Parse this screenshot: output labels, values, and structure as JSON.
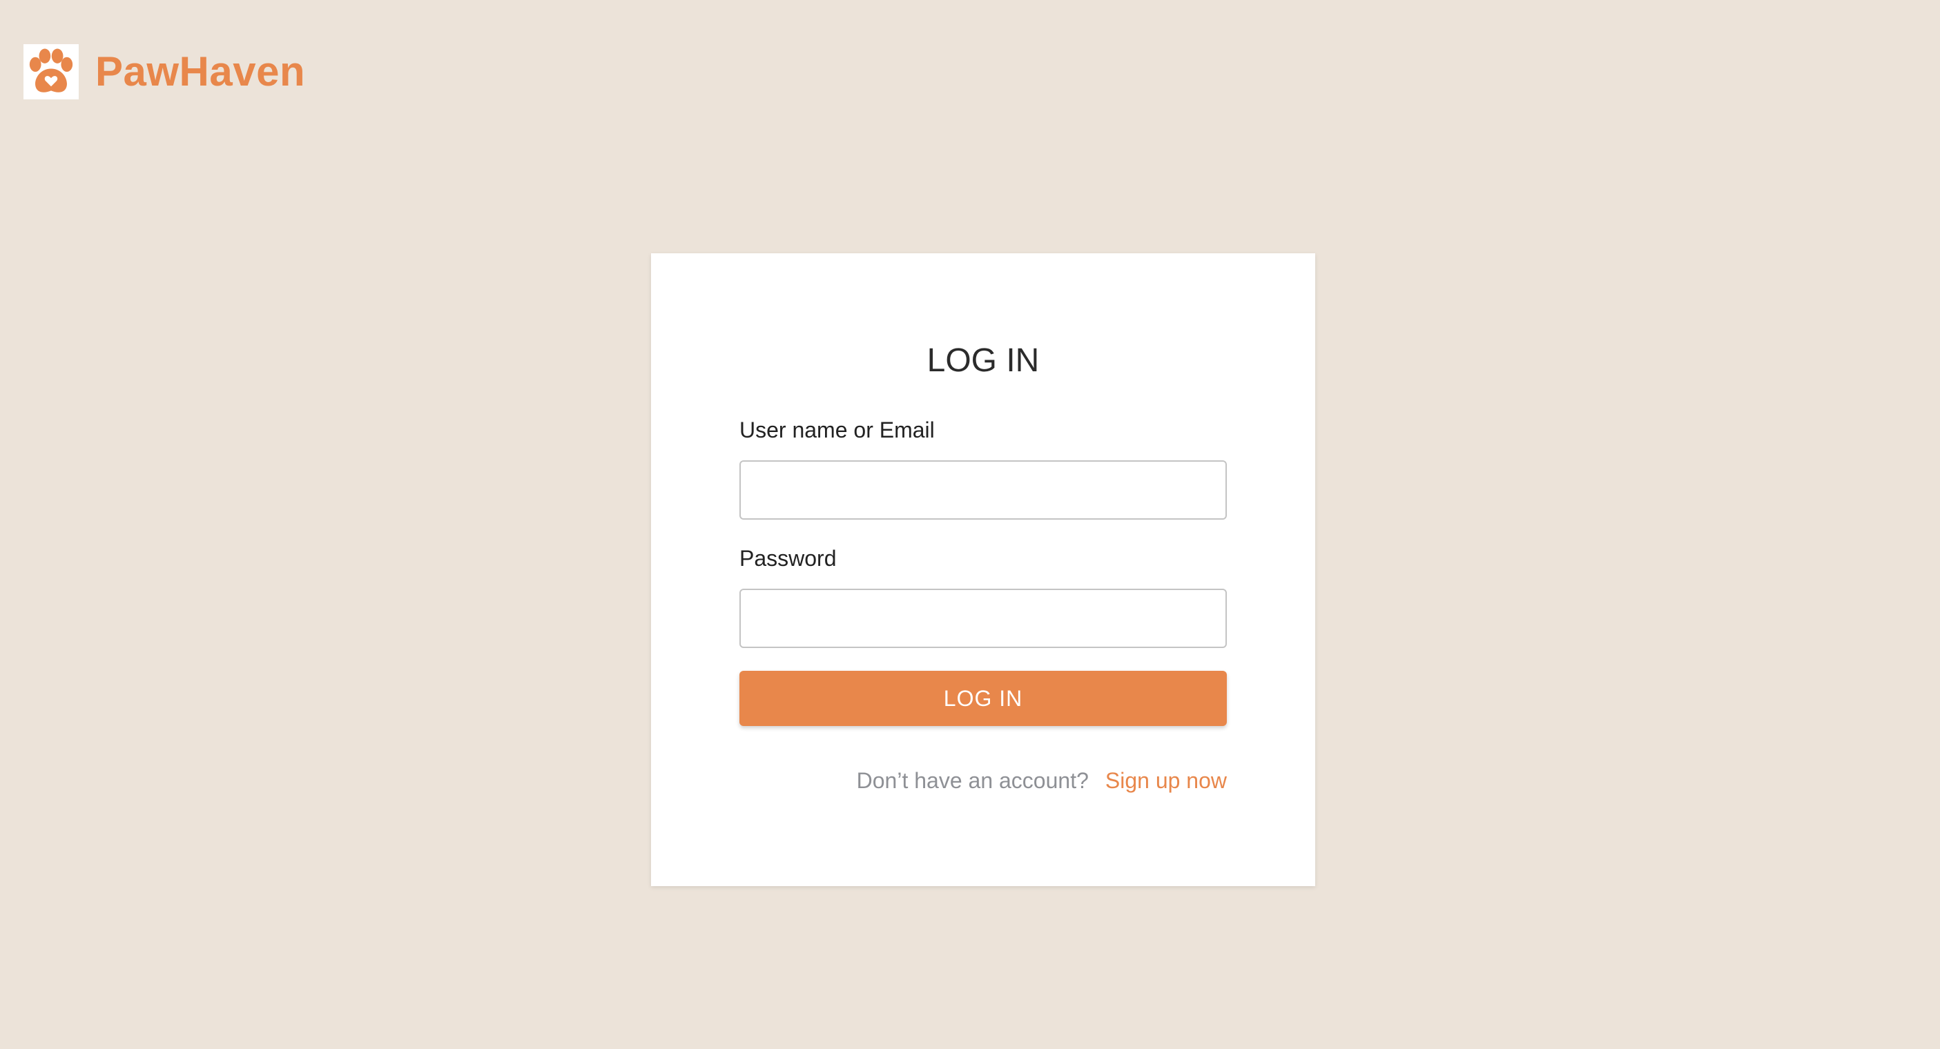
{
  "brand": {
    "name": "PawHaven",
    "logo_icon": "paw-heart-icon",
    "color": "#e8874b"
  },
  "login": {
    "title": "LOG IN",
    "username_label": "User name or Email",
    "username_value": "",
    "password_label": "Password",
    "password_value": "",
    "submit_label": "LOG IN",
    "signup_prompt": "Don’t have an account?",
    "signup_link": "Sign up now"
  },
  "colors": {
    "background": "#ece3d9",
    "card": "#ffffff",
    "accent": "#e8874b",
    "muted_text": "#8e9095"
  }
}
